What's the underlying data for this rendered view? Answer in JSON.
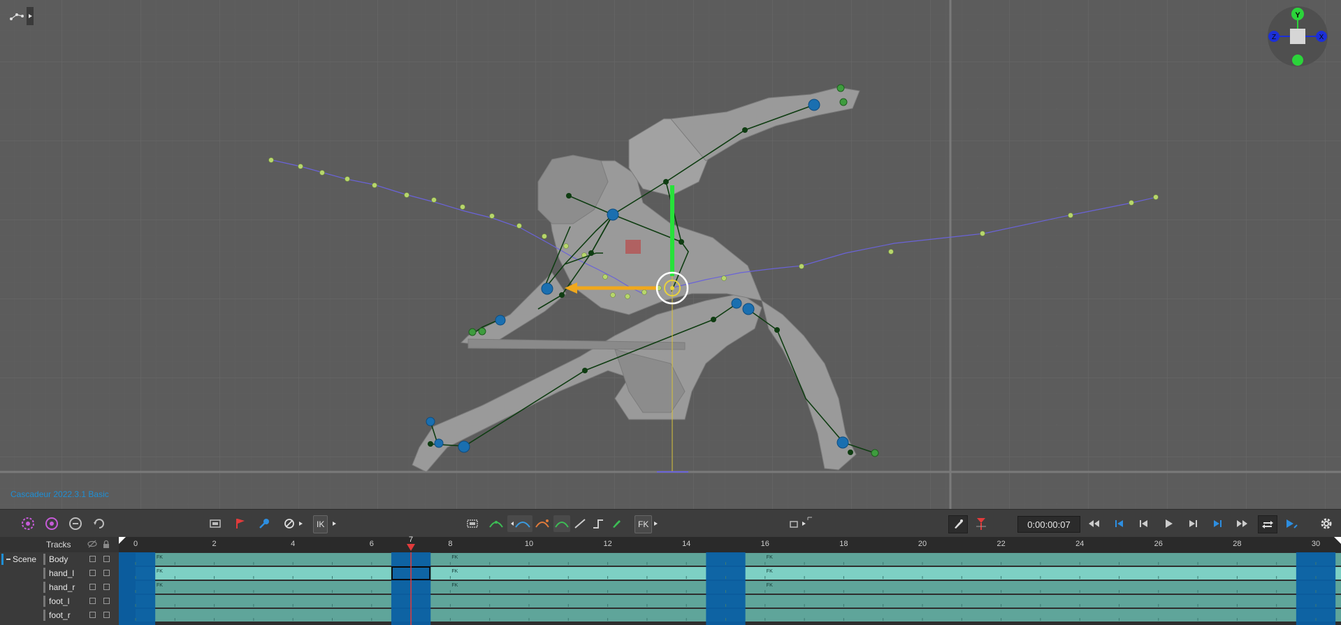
{
  "app": {
    "version_label": "Cascadeur 2022.3.1 Basic"
  },
  "viewport": {
    "gizmo": {
      "y_label": "Y",
      "z_label": "Z",
      "x_label": "X"
    }
  },
  "toolbar": {
    "ik_label": "IK",
    "fk_label": "FK",
    "time_display": "0:00:00:07",
    "icons": [
      "select-mode-icon",
      "rotate-mode-icon",
      "tween-mode-icon",
      "refresh-mode-icon",
      "frame-select-icon",
      "flag-icon",
      "key-icon",
      "disable-icon",
      "interpolation-icons",
      "playback-controls",
      "settings-icon"
    ]
  },
  "timeline": {
    "tracks_label": "Tracks",
    "scene_label": "Scene",
    "tracks": [
      "Body",
      "hand_l",
      "hand_r",
      "foot_l",
      "foot_r"
    ],
    "ruler_labels": [
      "0",
      "2",
      "4",
      "6",
      "8",
      "10",
      "12",
      "14",
      "16",
      "18",
      "20",
      "22",
      "24",
      "26",
      "28",
      "30"
    ],
    "current_frame": "7",
    "interval_label": "FK",
    "colors": {
      "interval": "#5fa59a",
      "selected_row": "#7dd0c4",
      "keyframe": "#0a5fa3",
      "playhead": "#e23b3b",
      "accent": "#1e8fd6"
    }
  }
}
